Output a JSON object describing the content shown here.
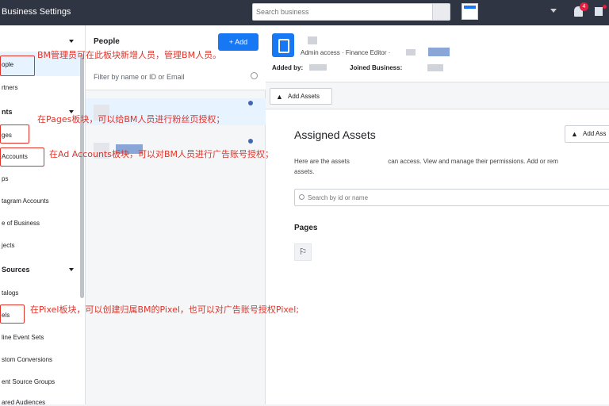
{
  "topbar": {
    "title": "Business Settings",
    "search_placeholder": "Search business",
    "notification_count": "4"
  },
  "sidebar": {
    "items": [
      {
        "label": "ople",
        "type": "item"
      },
      {
        "label": "rtners",
        "type": "item"
      },
      {
        "label": "nts",
        "type": "section"
      },
      {
        "label": "ges",
        "type": "item"
      },
      {
        "label": "Accounts",
        "type": "item"
      },
      {
        "label": "ps",
        "type": "item"
      },
      {
        "label": "tagram Accounts",
        "type": "item"
      },
      {
        "label": "e of Business",
        "type": "item"
      },
      {
        "label": "jects",
        "type": "item"
      },
      {
        "label": "Sources",
        "type": "section"
      },
      {
        "label": "talogs",
        "type": "item"
      },
      {
        "label": "els",
        "type": "item"
      },
      {
        "label": "line Event Sets",
        "type": "item"
      },
      {
        "label": "stom Conversions",
        "type": "item"
      },
      {
        "label": "ent Source Groups",
        "type": "item"
      },
      {
        "label": "ared Audiences",
        "type": "item"
      }
    ]
  },
  "people_panel": {
    "title": "People",
    "add_label": "Add",
    "filter_placeholder": "Filter by name or ID or Email"
  },
  "detail": {
    "role_text": "Admin access · Finance Editor ·",
    "added_by_label": "Added by:",
    "joined_label": "Joined Business:",
    "add_assets_label": "Add Assets",
    "assigned_title": "Assigned Assets",
    "add_assets_right_label": "Add Ass",
    "description_1": "Here are the assets",
    "description_2": "can access. View and manage their permissions. Add or rem",
    "description_3": "assets.",
    "search_placeholder": "Search by id or name",
    "pages_label": "Pages"
  },
  "annotations": {
    "people": "BM管理员可在此板块新增人员，管理BM人员。",
    "pages": "在Pages板块，可以给BM人员进行粉丝页授权；",
    "ad_accounts": "在Ad Accounts板块，可以对BM人员进行广告账号授权；",
    "pixels": "在Pixel板块，可以创建归属BM的Pixel，也可以对广告账号授权Pixel;"
  },
  "colors": {
    "topbar": "#2f3543",
    "accent": "#1877f2",
    "annotation": "#e0342a"
  }
}
